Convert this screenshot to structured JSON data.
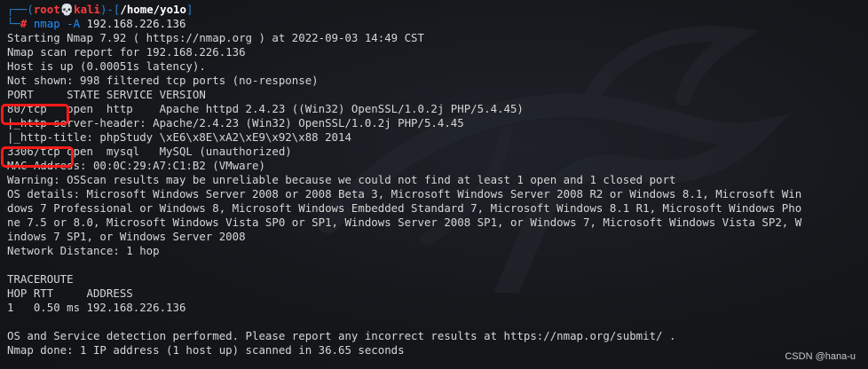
{
  "prompt": {
    "frame_top": "┌──(",
    "user": "root",
    "skull": "💀",
    "host": "kali",
    "frame_mid": ")-[",
    "path": "/home/yo1o",
    "frame_end": "]",
    "frame_bottom": "└─",
    "hash": "# ",
    "command": "nmap",
    "flag": " -A",
    "argument": " 192.168.226.136"
  },
  "output_lines": [
    "Starting Nmap 7.92 ( https://nmap.org ) at 2022-09-03 14:49 CST",
    "Nmap scan report for 192.168.226.136",
    "Host is up (0.00051s latency).",
    "Not shown: 998 filtered tcp ports (no-response)",
    "PORT     STATE SERVICE VERSION",
    "80/tcp   open  http    Apache httpd 2.4.23 ((Win32) OpenSSL/1.0.2j PHP/5.4.45)",
    "|_http-server-header: Apache/2.4.23 (Win32) OpenSSL/1.0.2j PHP/5.4.45",
    "|_http-title: phpStudy \\xE6\\x8E\\xA2\\xE9\\x92\\x88 2014",
    "3306/tcp open  mysql   MySQL (unauthorized)",
    "MAC Address: 00:0C:29:A7:C1:B2 (VMware)",
    "Warning: OSScan results may be unreliable because we could not find at least 1 open and 1 closed port",
    "OS details: Microsoft Windows Server 2008 or 2008 Beta 3, Microsoft Windows Server 2008 R2 or Windows 8.1, Microsoft Win",
    "dows 7 Professional or Windows 8, Microsoft Windows Embedded Standard 7, Microsoft Windows 8.1 R1, Microsoft Windows Pho",
    "ne 7.5 or 8.0, Microsoft Windows Vista SP0 or SP1, Windows Server 2008 SP1, or Windows 7, Microsoft Windows Vista SP2, W",
    "indows 7 SP1, or Windows Server 2008",
    "Network Distance: 1 hop",
    "",
    "TRACEROUTE",
    "HOP RTT     ADDRESS",
    "1   0.50 ms 192.168.226.136",
    "",
    "OS and Service detection performed. Please report any incorrect results at https://nmap.org/submit/ .",
    "Nmap done: 1 IP address (1 host up) scanned in 36.65 seconds"
  ],
  "watermark": "CSDN @hana-u",
  "colors": {
    "background": "#14161a",
    "text": "#d6d6d6",
    "prompt_frame": "#2f7fd0",
    "prompt_user": "#ff3b3b",
    "command": "#1e90ff",
    "highlight_box": "#ff1a1a"
  }
}
